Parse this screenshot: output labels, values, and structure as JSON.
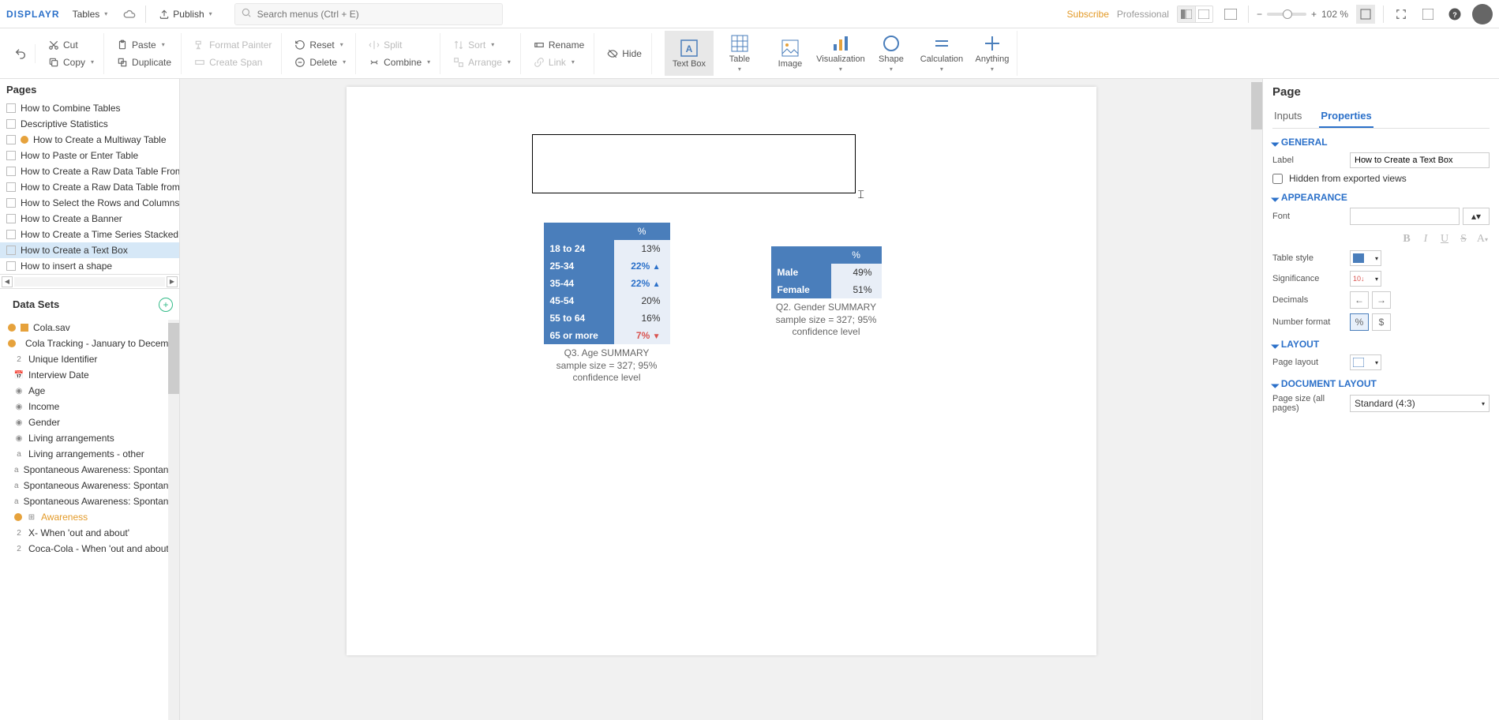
{
  "topbar": {
    "logo": "DISPLAYR",
    "tables_menu": "Tables",
    "publish_menu": "Publish",
    "search_placeholder": "Search menus (Ctrl + E)",
    "subscribe": "Subscribe",
    "professional": "Professional",
    "zoom_value": "102 %"
  },
  "ribbon": {
    "cut": "Cut",
    "copy": "Copy",
    "paste": "Paste",
    "duplicate": "Duplicate",
    "format_painter": "Format Painter",
    "create_span": "Create Span",
    "reset": "Reset",
    "delete": "Delete",
    "split": "Split",
    "combine": "Combine",
    "sort": "Sort",
    "arrange": "Arrange",
    "rename": "Rename",
    "link": "Link",
    "hide": "Hide",
    "textbox": "Text Box",
    "table": "Table",
    "image": "Image",
    "visualization": "Visualization",
    "shape": "Shape",
    "calculation": "Calculation",
    "anything": "Anything"
  },
  "pages": {
    "heading": "Pages",
    "items": [
      {
        "label": "How to Combine Tables",
        "warn": false
      },
      {
        "label": "Descriptive Statistics",
        "warn": false
      },
      {
        "label": "How to Create a Multiway Table",
        "warn": true
      },
      {
        "label": "How to Paste or Enter Table",
        "warn": false
      },
      {
        "label": "How to Create a Raw Data Table From a V",
        "warn": false
      },
      {
        "label": "How to Create a Raw Data Table from Var",
        "warn": false
      },
      {
        "label": "How to Select the Rows and Columns to A",
        "warn": false
      },
      {
        "label": "How to Create a Banner",
        "warn": false
      },
      {
        "label": "How to Create a Time Series Stacked by Y",
        "warn": false
      },
      {
        "label": "How to Create a Text Box",
        "warn": false,
        "active": true
      },
      {
        "label": "How to insert a shape",
        "warn": false
      }
    ]
  },
  "datasets": {
    "heading": "Data Sets",
    "items": [
      {
        "label": "Cola.sav",
        "type": "file",
        "root": true,
        "warn": true
      },
      {
        "label": "Cola Tracking - January to December.",
        "type": "file",
        "root": true,
        "warn": true
      },
      {
        "label": "Unique Identifier",
        "type": "2"
      },
      {
        "label": "Interview Date",
        "type": "cal"
      },
      {
        "label": "Age",
        "type": "g"
      },
      {
        "label": "Income",
        "type": "g"
      },
      {
        "label": "Gender",
        "type": "g"
      },
      {
        "label": "Living arrangements",
        "type": "g"
      },
      {
        "label": "Living arrangements - other",
        "type": "a"
      },
      {
        "label": "Spontaneous Awareness: Spontaneou",
        "type": "a"
      },
      {
        "label": "Spontaneous Awareness: Spontaneou",
        "type": "a"
      },
      {
        "label": "Spontaneous Awareness: Spontaneou",
        "type": "a"
      },
      {
        "label": "Awareness",
        "type": "grid",
        "highlight": true,
        "warn": true
      },
      {
        "label": "X- When 'out and about'",
        "type": "2"
      },
      {
        "label": "Coca-Cola - When 'out and about'",
        "type": "2"
      }
    ]
  },
  "chart_data": [
    {
      "type": "table",
      "title": "Q3. Age SUMMARY",
      "caption_line1": "Q3. Age SUMMARY",
      "caption_line2": "sample size = 327; 95% confidence level",
      "header": "%",
      "rows": [
        {
          "label": "18 to 24",
          "value": "13%",
          "sig": ""
        },
        {
          "label": "25-34",
          "value": "22%",
          "sig": "up"
        },
        {
          "label": "35-44",
          "value": "22%",
          "sig": "up"
        },
        {
          "label": "45-54",
          "value": "20%",
          "sig": ""
        },
        {
          "label": "55 to 64",
          "value": "16%",
          "sig": ""
        },
        {
          "label": "65 or more",
          "value": "7%",
          "sig": "down"
        }
      ]
    },
    {
      "type": "table",
      "title": "Q2. Gender SUMMARY",
      "caption_line1": "Q2. Gender SUMMARY",
      "caption_line2": "sample size = 327; 95% confidence level",
      "header": "%",
      "rows": [
        {
          "label": "Male",
          "value": "49%"
        },
        {
          "label": "Female",
          "value": "51%"
        }
      ]
    }
  ],
  "right": {
    "heading": "Page",
    "tab_inputs": "Inputs",
    "tab_properties": "Properties",
    "sec_general": "GENERAL",
    "label_lbl": "Label",
    "label_value": "How to Create a Text Box",
    "hidden_lbl": "Hidden from exported views",
    "sec_appearance": "APPEARANCE",
    "font_lbl": "Font",
    "table_style_lbl": "Table style",
    "significance_lbl": "Significance",
    "decimals_lbl": "Decimals",
    "number_format_lbl": "Number format",
    "pct_sign": "%",
    "dollar_sign": "$",
    "sec_layout": "LAYOUT",
    "page_layout_lbl": "Page layout",
    "sec_doc_layout": "DOCUMENT LAYOUT",
    "page_size_lbl": "Page size (all pages)",
    "page_size_val": "Standard (4:3)"
  }
}
